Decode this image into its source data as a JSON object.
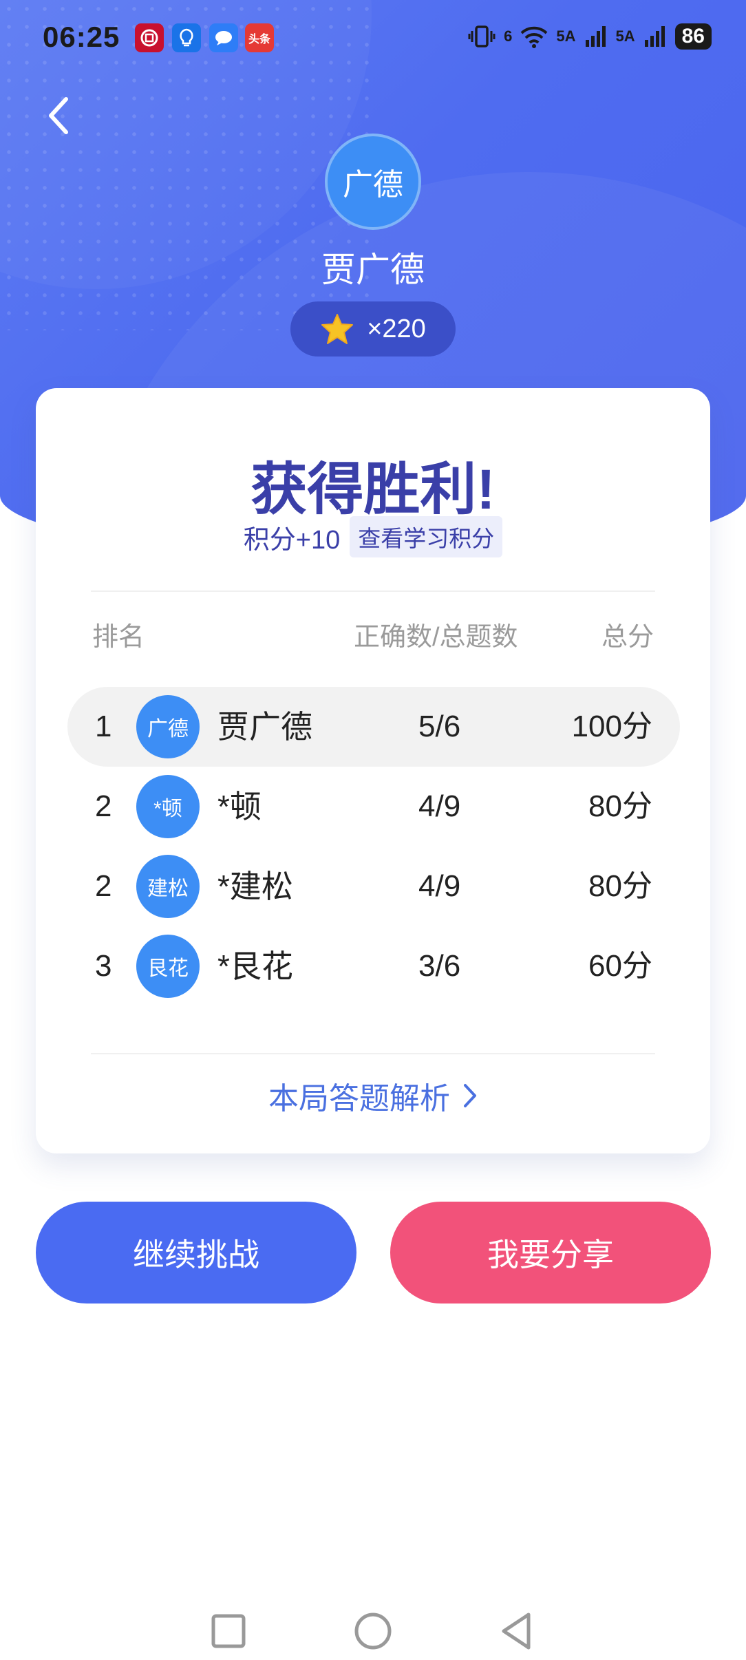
{
  "status_bar": {
    "time": "06:25",
    "app_icons": [
      "ccb-bank-icon",
      "bulb-app-icon",
      "message-app-icon",
      "toutiao-app-icon"
    ],
    "toutiao_label": "头条",
    "signal1_label": "5A",
    "signal2_label": "5A",
    "wifi_label": "6",
    "battery": "86"
  },
  "header": {
    "avatar_text": "广德",
    "username": "贾广德",
    "stars": "×220"
  },
  "result": {
    "title": "获得胜利!",
    "points": "积分+10",
    "points_link": "查看学习积分"
  },
  "table": {
    "col_rank": "排名",
    "col_correct": "正确数/总题数",
    "col_score": "总分",
    "rows": [
      {
        "rank": "1",
        "avatar": "广德",
        "name": "贾广德",
        "correct": "5/6",
        "score": "100分"
      },
      {
        "rank": "2",
        "avatar": "*顿",
        "name": "*顿",
        "correct": "4/9",
        "score": "80分"
      },
      {
        "rank": "2",
        "avatar": "建松",
        "name": "*建松",
        "correct": "4/9",
        "score": "80分"
      },
      {
        "rank": "3",
        "avatar": "艮花",
        "name": "*艮花",
        "correct": "3/6",
        "score": "60分"
      }
    ]
  },
  "analysis_link": "本局答题解析",
  "buttons": {
    "continue": "继续挑战",
    "share": "我要分享"
  },
  "colors": {
    "hero_blue": "#4f6cf0",
    "title_indigo": "#3a3fa8",
    "continue_blue": "#4a6bf2",
    "share_pink": "#f2527a",
    "avatar_blue": "#3d8ef5"
  }
}
